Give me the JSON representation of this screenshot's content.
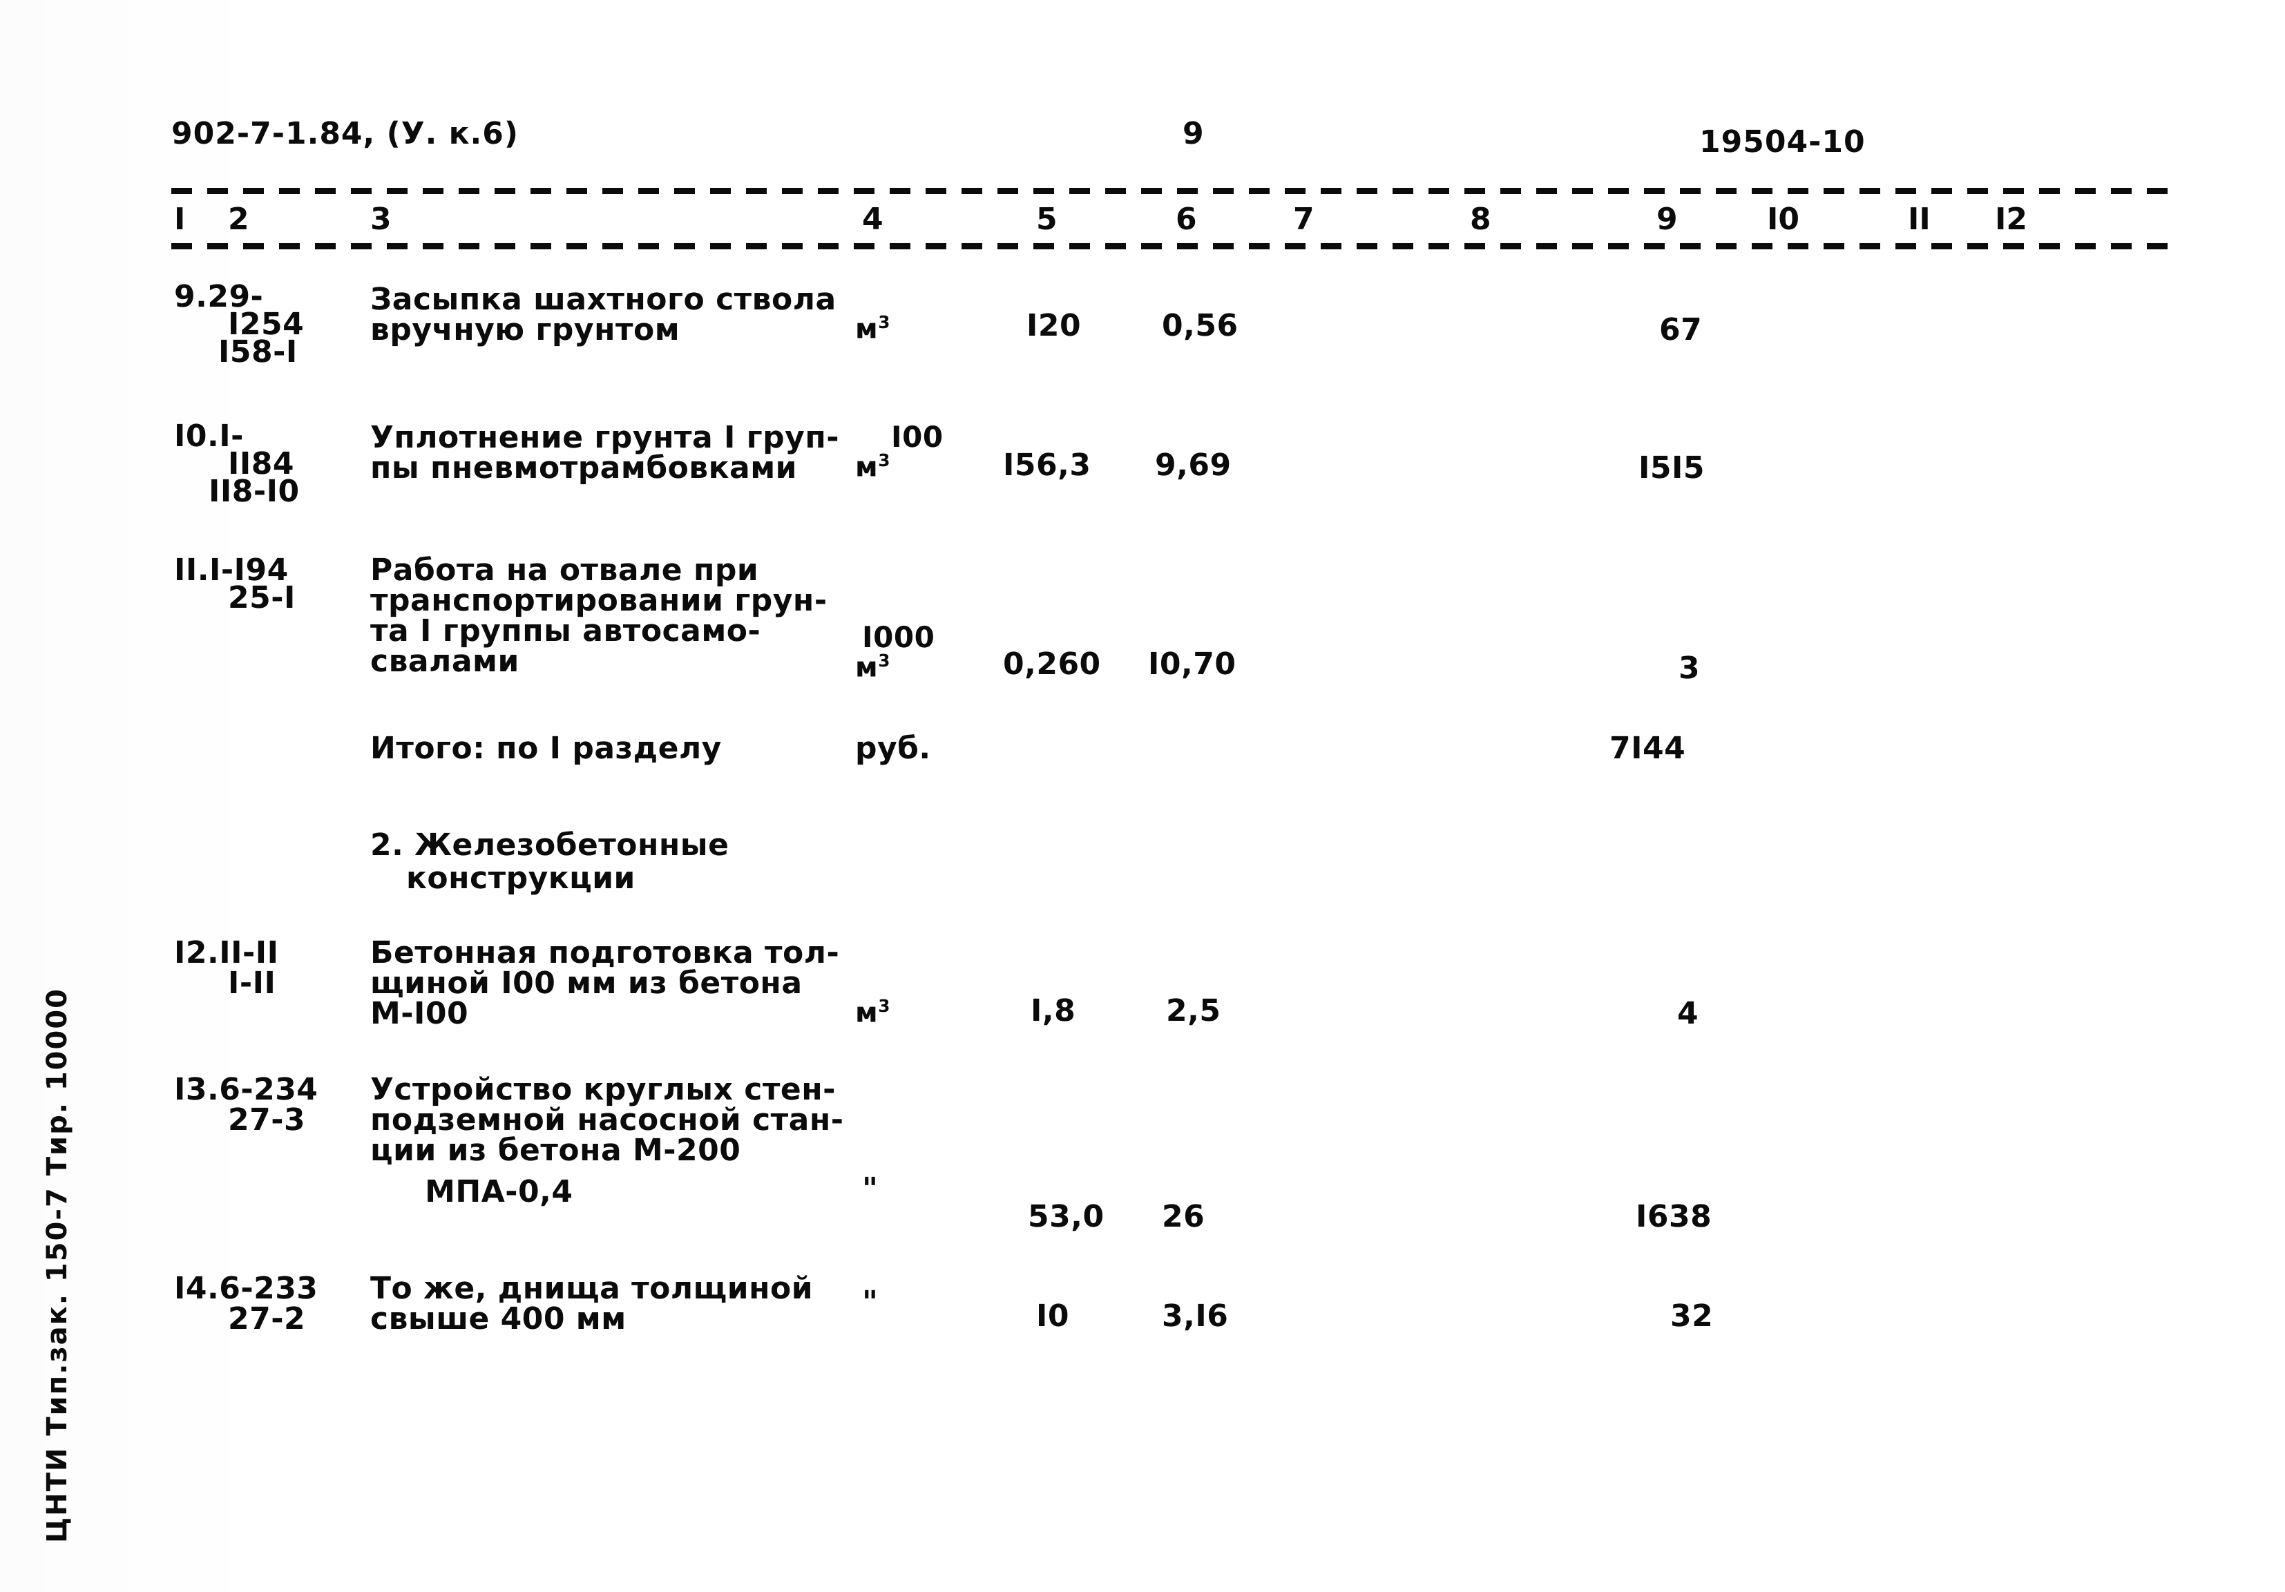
{
  "header": {
    "doc_code": "902-7-1.84, (У. к.6)",
    "page_number": "9",
    "sheet_number": "19504-10"
  },
  "table": {
    "column_numbers": [
      "I",
      "2",
      "3",
      "4",
      "5",
      "6",
      "7",
      "8",
      "9",
      "I0",
      "II",
      "I2"
    ],
    "rows": [
      {
        "code_line1": "9.29-",
        "code_line2": "I254",
        "code_line3": "I58-I",
        "description": [
          "Засыпка шахтного ствола",
          "вручную грунтом"
        ],
        "unit": "м",
        "unit_sup": "3",
        "unit_prefix": "",
        "col5": "I20",
        "col6": "0,56",
        "col7": "",
        "col8": "",
        "col9": "67",
        "col10": "",
        "col11": "",
        "col12": ""
      },
      {
        "code_line1": "I0.I-",
        "code_line2": "II84",
        "code_line3": "II8-I0",
        "description": [
          "Уплотнение грунта I груп-",
          "пы пневмотрамбовками"
        ],
        "unit": "м",
        "unit_sup": "3",
        "unit_prefix": "I00",
        "col5": "I56,3",
        "col6": "9,69",
        "col7": "",
        "col8": "",
        "col9": "I5I5",
        "col10": "",
        "col11": "",
        "col12": ""
      },
      {
        "code_line1": "II.I-I94",
        "code_line2": "25-I",
        "code_line3": "",
        "description": [
          "Работа на отвале при",
          "транспортировании грун-",
          "та I группы автосамо-",
          "свалами"
        ],
        "unit": "м",
        "unit_sup": "3",
        "unit_prefix": "I000",
        "col5": "0,260",
        "col6": "I0,70",
        "col7": "",
        "col8": "",
        "col9": "3",
        "col10": "",
        "col11": "",
        "col12": ""
      },
      {
        "code_line1": "",
        "code_line2": "",
        "code_line3": "",
        "description": [
          "Итого: по I разделу"
        ],
        "unit": "руб.",
        "unit_sup": "",
        "unit_prefix": "",
        "col5": "",
        "col6": "",
        "col7": "",
        "col8": "",
        "col9": "7I44",
        "col10": "",
        "col11": "",
        "col12": ""
      }
    ],
    "section_heading": [
      "2. Железобетонные",
      "конструкции"
    ],
    "rows2": [
      {
        "code_line1": "I2.II-II",
        "code_line2": "I-II",
        "code_line3": "",
        "description": [
          "Бетонная подготовка тол-",
          "щиной I00 мм из бетона",
          "М-I00"
        ],
        "unit": "м",
        "unit_sup": "3",
        "unit_prefix": "",
        "col5": "I,8",
        "col6": "2,5",
        "col7": "",
        "col8": "",
        "col9": "4",
        "col10": "",
        "col11": "",
        "col12": ""
      },
      {
        "code_line1": "I3.6-234",
        "code_line2": "27-3",
        "code_line3": "",
        "description": [
          "Устройство круглых стен-",
          "подземной насосной стан-",
          "ции из бетона М-200",
          "     МПА-0,4"
        ],
        "unit": "\"",
        "unit_sup": "",
        "unit_prefix": "",
        "col5": "53,0",
        "col6": "26",
        "col7": "",
        "col8": "",
        "col9": "I638",
        "col10": "",
        "col11": "",
        "col12": ""
      },
      {
        "code_line1": "I4.6-233",
        "code_line2": "27-2",
        "code_line3": "",
        "description": [
          "То же, днища толщиной",
          "свыше 400 мм"
        ],
        "unit": "\"",
        "unit_sup": "",
        "unit_prefix": "",
        "col5": "I0",
        "col6": "3,I6",
        "col7": "",
        "col8": "",
        "col9": "32",
        "col10": "",
        "col11": "",
        "col12": ""
      }
    ]
  },
  "imprint": "ЦНТИ Тип.зак. 150-7 Тир. 10000"
}
